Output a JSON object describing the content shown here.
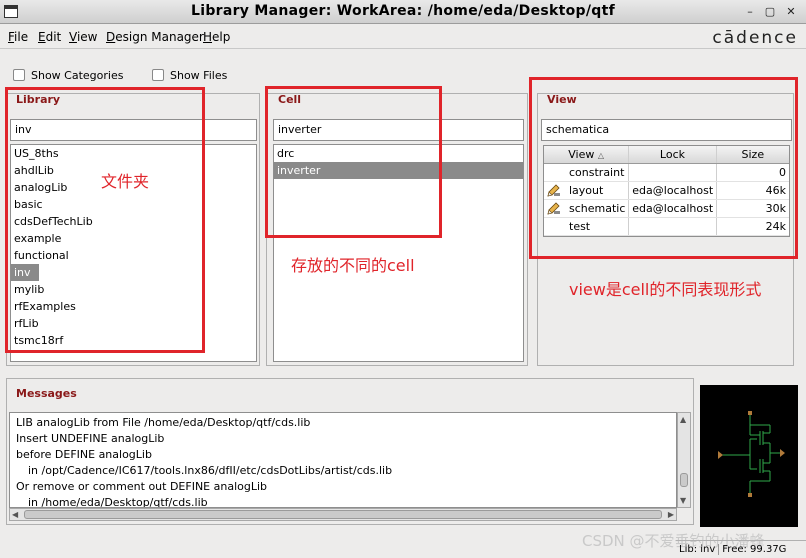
{
  "window": {
    "title": "Library Manager: WorkArea: /home/eda/Desktop/qtf",
    "minimize": "–",
    "maximize": "▢",
    "close": "✕"
  },
  "menu": {
    "file": {
      "u": "F",
      "rest": "ile"
    },
    "edit": {
      "u": "E",
      "rest": "dit"
    },
    "view": {
      "u": "V",
      "rest": "iew"
    },
    "design_manager": {
      "u": "D",
      "rest": "esign Manager"
    },
    "help": {
      "u": "H",
      "rest": "elp"
    }
  },
  "brand": "cādence",
  "options": {
    "show_categories": "Show Categories",
    "show_files": "Show Files"
  },
  "library": {
    "label": "Library",
    "filter_value": "inv",
    "items": [
      "US_8ths",
      "ahdlLib",
      "analogLib",
      "basic",
      "cdsDefTechLib",
      "example",
      "functional",
      "inv",
      "mylib",
      "rfExamples",
      "rfLib",
      "tsmc18rf"
    ],
    "selected": "inv"
  },
  "cell": {
    "label": "Cell",
    "filter_value": "inverter",
    "items": [
      "drc",
      "inverter"
    ],
    "selected": "inverter"
  },
  "view": {
    "label": "View",
    "filter_value": "schematica",
    "columns": [
      "View",
      "Lock",
      "Size"
    ],
    "rows": [
      {
        "name": "constraint",
        "lock": "",
        "size": "0",
        "icon": "none"
      },
      {
        "name": "layout",
        "lock": "eda@localhost",
        "size": "46k",
        "icon": "pencil-icon"
      },
      {
        "name": "schematic",
        "lock": "eda@localhost",
        "size": "30k",
        "icon": "pencil-icon"
      },
      {
        "name": "test",
        "lock": "",
        "size": "24k",
        "icon": "none"
      }
    ]
  },
  "annotations": {
    "library": "文件夹",
    "cell": "存放的不同的cell",
    "view": "view是cell的不同表现形式"
  },
  "messages": {
    "label": "Messages",
    "lines": [
      "LIB analogLib from File /home/eda/Desktop/qtf/cds.lib",
      "Insert UNDEFINE analogLib",
      "before DEFINE analogLib",
      "  in /opt/Cadence/IC617/tools.lnx86/dfII/etc/cdsDotLibs/artist/cds.lib",
      "Or remove or comment out DEFINE analogLib",
      "  in /home/eda/Desktop/qtf/cds.lib"
    ],
    "scroll_fraction": 0.85
  },
  "status": {
    "lib": "Lib: inv",
    "free": "Free: 99.37G"
  },
  "watermark": "CSDN @不爱垂钓的小潘蜂",
  "colors": {
    "annotation_red": "#e0242a",
    "panel_label": "#8a1818",
    "selection": "#8a8a8a",
    "schematic_wire": "#2fa84a",
    "schematic_pin": "#b07a3a"
  }
}
